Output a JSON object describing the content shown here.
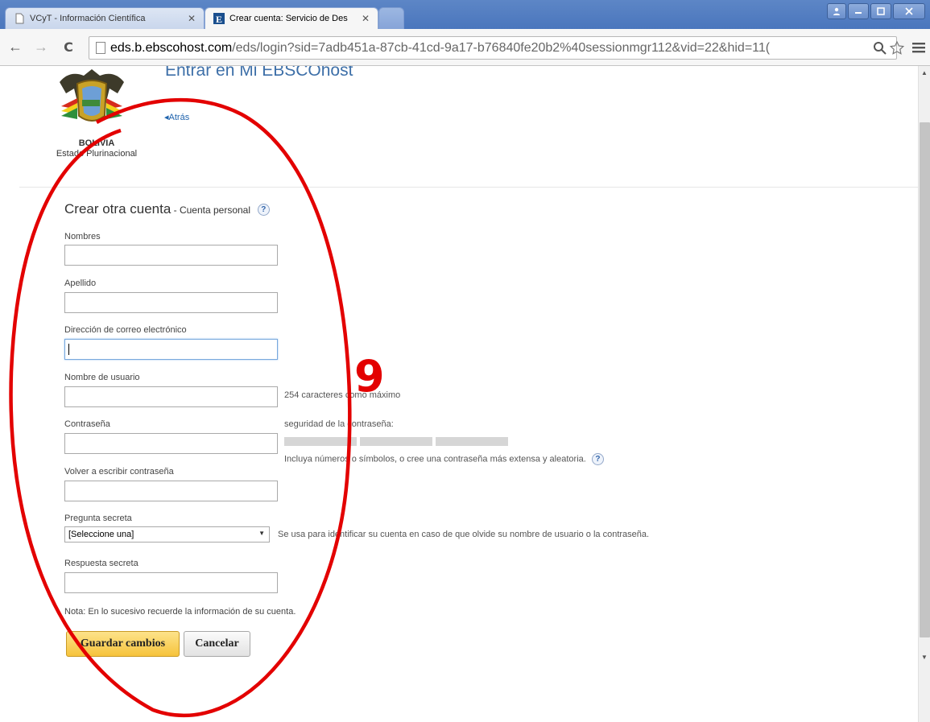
{
  "browser": {
    "tabs": [
      {
        "label": "VCyT - Información Científica",
        "state": "inactive",
        "icon": "page-icon"
      },
      {
        "label": "Crear cuenta: Servicio de Des",
        "state": "active",
        "icon": "ebsco-favicon-icon"
      },
      {
        "label": "",
        "state": "new",
        "icon": ""
      }
    ],
    "window_buttons": [
      "user-icon",
      "minimize-icon",
      "maximize-icon",
      "close-icon"
    ],
    "url_host": "eds.b.ebscohost.com",
    "url_path": "/eds/login?sid=7adb451a-87cb-41cd-9a17-b76840fe20b2%40sessionmgr112&vid=22&hid=11",
    "url_suffix": "(",
    "tab_close_glyph": "✕",
    "back_glyph": "←",
    "forward_glyph": "→",
    "reload_glyph": "C",
    "ebsco_favicon_letter": "E"
  },
  "header": {
    "logo_text_line1": "BOLIVIA",
    "logo_text_line2": "Estado Plurinacional",
    "title": "Entrar en Mi EBSCOhost",
    "back_link": "◂Atrás"
  },
  "form": {
    "section_title": "Crear otra cuenta",
    "section_subtitle": " - Cuenta personal",
    "help_glyph": "?",
    "fields": {
      "first_name_label": "Nombres",
      "last_name_label": "Apellido",
      "email_label": "Dirección de correo electrónico",
      "username_label": "Nombre de usuario",
      "username_hint": "254 caracteres como máximo",
      "password_label": "Contraseña",
      "password_strength_label": "seguridad de la contraseña:",
      "password_hint": "Incluya números o símbolos, o cree una contraseña más extensa y aleatoria.",
      "confirm_password_label": "Volver a escribir contraseña",
      "secret_question_label": "Pregunta secreta",
      "secret_question_value": "[Seleccione una]",
      "secret_question_hint": "Se usa para identificar su cuenta en caso de que olvide su nombre de usuario o la contraseña.",
      "secret_answer_label": "Respuesta secreta"
    },
    "note": "Nota: En lo sucesivo recuerde la información de su cuenta.",
    "save_button": "Guardar cambios",
    "cancel_button": "Cancelar"
  },
  "annotation": {
    "number": "9",
    "color": "#e30000"
  },
  "colors": {
    "title_blue": "#3d6fa8",
    "link_blue": "#1f63ad",
    "primary_button": "#f6c33c",
    "tabstrip": "#4a76bd"
  }
}
